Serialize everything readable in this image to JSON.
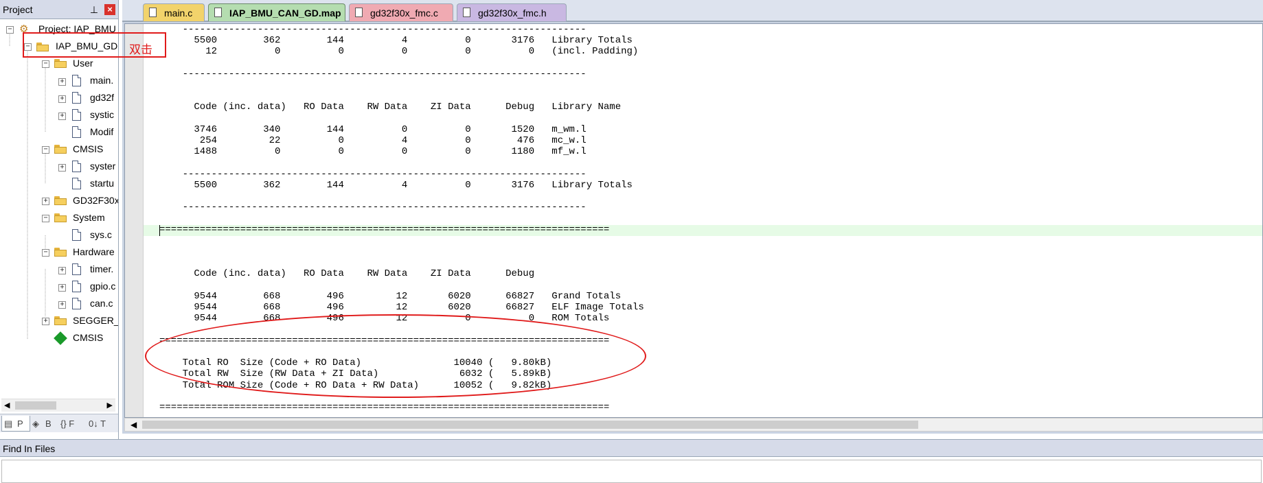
{
  "project_panel": {
    "title": "Project",
    "tabs": [
      {
        "icon": "P-book-icon",
        "label": "P"
      },
      {
        "icon": "books-icon",
        "label": "B"
      },
      {
        "icon": "braces-icon",
        "label": "{} F"
      },
      {
        "icon": "template-icon",
        "label": "0↓ T"
      }
    ],
    "tree": [
      {
        "label": "Project: IAP_BMU",
        "icon": "project-root-icon"
      },
      {
        "label": "IAP_BMU_GD",
        "icon": "target-icon"
      },
      {
        "label": "User",
        "icon": "folder-icon"
      },
      {
        "label": "main.",
        "icon": "file-icon"
      },
      {
        "label": "gd32f",
        "icon": "file-icon"
      },
      {
        "label": "systic",
        "icon": "file-icon"
      },
      {
        "label": "Modif",
        "icon": "file-icon"
      },
      {
        "label": "CMSIS",
        "icon": "folder-icon"
      },
      {
        "label": "syster",
        "icon": "file-icon"
      },
      {
        "label": "startu",
        "icon": "file-icon"
      },
      {
        "label": "GD32F30x",
        "icon": "folder-icon"
      },
      {
        "label": "System",
        "icon": "folder-icon"
      },
      {
        "label": "sys.c",
        "icon": "file-icon"
      },
      {
        "label": "Hardware",
        "icon": "folder-icon"
      },
      {
        "label": "timer.",
        "icon": "file-icon"
      },
      {
        "label": "gpio.c",
        "icon": "file-icon"
      },
      {
        "label": "can.c",
        "icon": "file-icon"
      },
      {
        "label": "SEGGER_R",
        "icon": "folder-icon"
      },
      {
        "label": "CMSIS",
        "icon": "cmsis-diamond-icon"
      }
    ]
  },
  "editor": {
    "tabs": [
      {
        "label": "main.c",
        "color": "#f2d36b"
      },
      {
        "label": "IAP_BMU_CAN_GD.map",
        "color": "#b5ddb0",
        "active": true
      },
      {
        "label": "gd32f30x_fmc.c",
        "color": "#f0aab2"
      },
      {
        "label": "gd32f30x_fmc.h",
        "color": "#c9b8e2"
      }
    ],
    "lines": [
      "    ----------------------------------------------------------------------",
      "      5500        362        144          4          0       3176   Library Totals",
      "        12          0          0          0          0          0   (incl. Padding)",
      "",
      "    ----------------------------------------------------------------------",
      "",
      "",
      "      Code (inc. data)   RO Data    RW Data    ZI Data      Debug   Library Name",
      "",
      "      3746        340        144          0          0       1520   m_wm.l",
      "       254         22          0          4          0        476   mc_w.l",
      "      1488          0          0          0          0       1180   mf_w.l",
      "",
      "    ----------------------------------------------------------------------",
      "      5500        362        144          4          0       3176   Library Totals",
      "",
      "    ----------------------------------------------------------------------",
      "",
      "==============================================================================",
      "",
      "",
      "",
      "      Code (inc. data)   RO Data    RW Data    ZI Data      Debug",
      "",
      "      9544        668        496         12       6020      66827   Grand Totals",
      "      9544        668        496         12       6020      66827   ELF Image Totals",
      "      9544        668        496         12          0          0   ROM Totals",
      "",
      "==============================================================================",
      "",
      "    Total RO  Size (Code + RO Data)                10040 (   9.80kB)",
      "    Total RW  Size (RW Data + ZI Data)              6032 (   5.89kB)",
      "    Total ROM Size (Code + RO Data + RW Data)      10052 (   9.82kB)",
      "",
      "=============================================================================="
    ]
  },
  "find_panel": {
    "title": "Find In Files"
  },
  "annotations": {
    "double_click_label": "双击",
    "color": "#e01a1a"
  }
}
